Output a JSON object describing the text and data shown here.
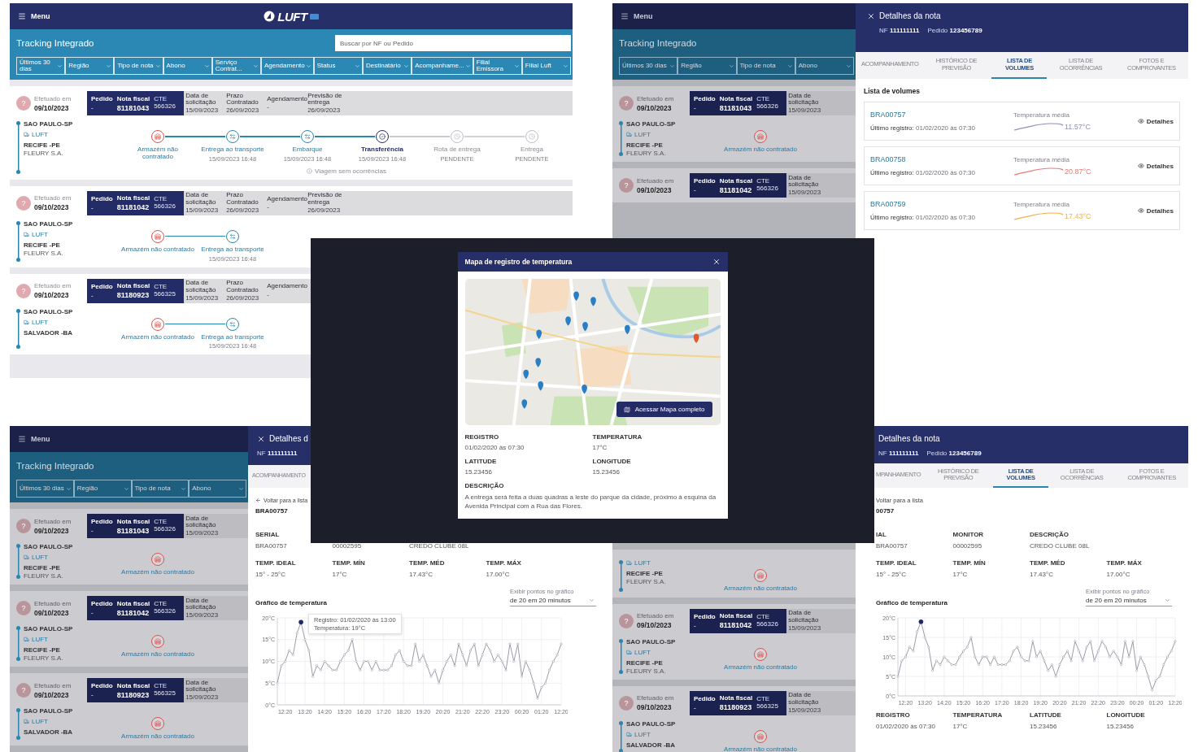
{
  "tracking_screen": {
    "dimmed": false,
    "menu": "Menu",
    "logo": "LUFT",
    "title": "Tracking Integrado",
    "search": {
      "placeholder": "Buscar por NF ou Pedido"
    },
    "filters": [
      "Últimos 30 dias",
      "Região",
      "Tipo de nota",
      "Abono",
      "Serviço Contrat...",
      "Agendamento",
      "Status",
      "Destinatário",
      "Acompanhame...",
      "Filial Emissora",
      "Filial Luft"
    ],
    "cards": [
      {
        "avatar": "?",
        "date_label": "Efetuado em",
        "date": "09/10/2023",
        "order_label": "Pedido",
        "order": "-",
        "invoice_label": "Nota fiscal",
        "invoice": "81181043",
        "cte": "CTE 566326",
        "info": [
          {
            "label": "Data de solicitação",
            "value": "15/09/2023"
          },
          {
            "label": "Prazo Contratado",
            "value": "26/09/2023"
          },
          {
            "label": "Agendamento",
            "value": "-"
          },
          {
            "label": "Previsão de entrega",
            "value": "26/09/2023"
          }
        ],
        "origin": "SAO PAULO-SP",
        "carrier": "LUFT",
        "destination": "RECIFE -PE",
        "company": "FLEURY S.A.",
        "steps": [
          {
            "kind": "alert",
            "label": "Armazém não contratado"
          },
          {
            "kind": "done",
            "label": "Entrega ao transporte",
            "time": "15/09/2023 16:48"
          },
          {
            "kind": "done",
            "label": "Embarque",
            "time": "15/09/2023 16:48"
          },
          {
            "kind": "current",
            "label": "Transferência",
            "time": "15/09/2023 16:48"
          },
          {
            "kind": "pending",
            "label": "Rota de entrega",
            "time": "PENDENTE"
          },
          {
            "kind": "pending",
            "label": "Entrega",
            "time": "PENDENTE"
          }
        ],
        "footer": "Viagem sem ocorrências"
      },
      {
        "avatar": "?",
        "date_label": "Efetuado em",
        "date": "09/10/2023",
        "order_label": "Pedido",
        "order": "-",
        "invoice_label": "Nota fiscal",
        "invoice": "81181042",
        "cte": "CTE 566326",
        "info": [
          {
            "label": "Data de solicitação",
            "value": "15/09/2023"
          },
          {
            "label": "Prazo Contratado",
            "value": "26/09/2023"
          },
          {
            "label": "Agendamento",
            "value": "-"
          },
          {
            "label": "Previsão de entrega",
            "value": "26/09/2023"
          }
        ],
        "origin": "SAO PAULO-SP",
        "carrier": "LUFT",
        "destination": "RECIFE -PE",
        "company": "FLEURY S.A.",
        "steps": [
          {
            "kind": "alert",
            "label": "Armazém não contratado"
          },
          {
            "kind": "done",
            "label": "Entrega ao transporte",
            "time": "15/09/2023 16:48"
          }
        ]
      },
      {
        "avatar": "?",
        "date_label": "Efetuado em",
        "date": "09/10/2023",
        "order_label": "Pedido",
        "order": "-",
        "invoice_label": "Nota fiscal",
        "invoice": "81180923",
        "cte": "CTE 566325",
        "info": [
          {
            "label": "Data de solicitação",
            "value": "15/09/2023"
          },
          {
            "label": "Prazo Contratado",
            "value": "26/09/2023"
          },
          {
            "label": "Agendamento",
            "value": "-"
          }
        ],
        "origin": "SAO PAULO-SP",
        "carrier": "LUFT",
        "destination": "SALVADOR -BA",
        "steps": [
          {
            "kind": "alert",
            "label": "Armazém não contratado"
          },
          {
            "kind": "done",
            "label": "Entrega ao transporte",
            "time": "15/09/2023 16:48"
          }
        ]
      }
    ]
  },
  "volumes_view": {
    "background": {
      "dimmed": true,
      "menu": "Menu",
      "title": "Tracking Integrado",
      "filters": [
        "Últimos 30 dias",
        "Região",
        "Tipo de nota",
        "Abono"
      ],
      "cards": [
        {
          "avatar": "?",
          "date_label": "Efetuado em",
          "date": "09/10/2023",
          "order_label": "Pedido",
          "order": "-",
          "invoice_label": "Nota fiscal",
          "invoice": "81181043",
          "cte": "CTE 566326",
          "info": [
            {
              "label": "Data de solicitação",
              "value": "15/09/2023"
            }
          ],
          "origin": "SAO PAULO-SP",
          "carrier": "LUFT",
          "destination": "RECIFE -PE",
          "company": "FLEURY S.A.",
          "steps": [
            {
              "kind": "alert",
              "label": "Armazém não contratado"
            }
          ]
        },
        {
          "avatar": "?",
          "date_label": "Efetuado em",
          "date": "09/10/2023",
          "order_label": "Pedido",
          "order": "-",
          "invoice_label": "Nota fiscal",
          "invoice": "81181042",
          "cte": "CTE 566326",
          "info": [
            {
              "label": "Data de solicitação",
              "value": "15/09/2023"
            }
          ]
        }
      ]
    },
    "drawer": {
      "close": true,
      "title": "Detalhes da nota",
      "nf": "NF **111111111**",
      "order": "Pedido **123456789**",
      "tabs": [
        {
          "label": "ACOMPANHAMENTO",
          "selected": false
        },
        {
          "label": "HISTÓRICO DE PREVISÃO",
          "selected": false
        },
        {
          "label": "LISTA DE VOLUMES",
          "selected": true
        },
        {
          "label": "LISTA DE OCORRÊNCIAS",
          "selected": false
        },
        {
          "label": "FOTOS E COMPROVANTES",
          "selected": false
        }
      ],
      "section_title": "Lista de volumes",
      "volumes": [
        {
          "code": "BRA00757",
          "last": "**Último registro:** 01/02/2020 às 07:30",
          "temp_label": "Temperatura média",
          "temp": "11.57°C",
          "color": "#8d8fba",
          "action": "Detalhes"
        },
        {
          "code": "BRA00758",
          "last": "**Último registro:** 01/02/2020 às 07:30",
          "temp_label": "Temperatura média",
          "temp": "20.87°C",
          "color": "#e8797a",
          "action": "Detalhes"
        },
        {
          "code": "BRA00759",
          "last": "**Último registro:** 01/02/2020 às 07:30",
          "temp_label": "Temperatura média",
          "temp": "17.43°C",
          "color": "#f2b04a",
          "action": "Detalhes"
        }
      ]
    }
  },
  "map_view": {
    "modal": {
      "title": "Mapa de registro de temperatura",
      "map_button": "Acessar Mapa completo",
      "fields": [
        {
          "label": "REGISTRO",
          "value": "01/02/2020 às 07:30"
        },
        {
          "label": "TEMPERATURA",
          "value": "17°C"
        },
        {
          "label": "LATITUDE",
          "value": "15.23456"
        },
        {
          "label": "LONGITUDE",
          "value": "15.23456"
        }
      ],
      "description_label": "DESCRIÇÃO",
      "description": "A entrega será feita a duas quadras a leste do parque da cidade, próximo à esquina da Avenida Principal com a Rua das Flores."
    }
  },
  "chart_view_left": {
    "background": {
      "dimmed": true,
      "menu": "Menu",
      "title": "Tracking Integrado",
      "filters": [
        "Últimos 30 dias",
        "Região",
        "Tipo de nota",
        "Abono"
      ],
      "cards": [
        {
          "avatar": "?",
          "date_label": "Efetuado em",
          "date": "09/10/2023",
          "order_label": "Pedido",
          "order": "-",
          "invoice_label": "Nota fiscal",
          "invoice": "81181043",
          "cte": "CTE 566326",
          "info": [
            {
              "label": "Data de solicitação",
              "value": "15/09/2023"
            }
          ],
          "origin": "SAO PAULO-SP",
          "carrier": "LUFT",
          "destination": "RECIFE -PE",
          "company": "FLEURY S.A.",
          "steps": [
            {
              "kind": "alert",
              "label": "Armazém não contratado"
            }
          ]
        },
        {
          "avatar": "?",
          "date_label": "Efetuado em",
          "date": "09/10/2023",
          "order_label": "Pedido",
          "order": "-",
          "invoice_label": "Nota fiscal",
          "invoice": "81181042",
          "cte": "CTE 566326",
          "info": [
            {
              "label": "Data de solicitação",
              "value": "15/09/2023"
            }
          ],
          "origin": "SAO PAULO-SP",
          "carrier": "LUFT",
          "destination": "RECIFE -PE",
          "company": "FLEURY S.A.",
          "steps": [
            {
              "kind": "alert",
              "label": "Armazém não contratado"
            }
          ]
        },
        {
          "avatar": "?",
          "date_label": "Efetuado em",
          "date": "09/10/2023",
          "order_label": "Pedido",
          "order": "-",
          "invoice_label": "Nota fiscal",
          "invoice": "81180923",
          "cte": "CTE 566325",
          "info": [
            {
              "label": "Data de solicitação",
              "value": "15/09/2023"
            }
          ],
          "origin": "SAO PAULO-SP",
          "carrier": "LUFT",
          "destination": "SALVADOR -BA",
          "steps": [
            {
              "kind": "alert",
              "label": "Armazém não contratado"
            }
          ]
        }
      ]
    },
    "drawer": {
      "close": true,
      "title": "Detalhes d",
      "nf": "NF **111111111**",
      "tabs": [
        {
          "label": "ACOMPANHAMENTO",
          "selected": false
        }
      ],
      "back": "Voltar para a lista",
      "volume": "BRA00757",
      "fields": [
        {
          "label": "SERIAL",
          "value": "BRA00757"
        },
        {
          "value": "00002595"
        },
        {
          "value": "CREDO CLUBE 08L"
        }
      ],
      "temps": [
        {
          "label": "TEMP. IDEAL",
          "value": "15° - 25°C"
        },
        {
          "label": "TEMP. MÍN",
          "value": "17°C"
        },
        {
          "label": "TEMP. MÉD",
          "value": "17.43°C"
        },
        {
          "label": "TEMP. MÁX",
          "value": "17.00°C"
        }
      ],
      "chart_title": "Gráfico de temperatura",
      "select": {
        "label": "Exibir pontos no gráfico",
        "value": "de 20 em 20 minutos"
      },
      "chart_data": {
        "type": "line",
        "grid": true,
        "marker": true,
        "ylim": [
          0,
          20
        ],
        "yticks": [
          {
            "value": 0,
            "label": "0°C"
          },
          {
            "value": 5,
            "label": "5°C"
          },
          {
            "value": 10,
            "label": "10°C"
          },
          {
            "value": 15,
            "label": "15°C"
          },
          {
            "value": 20,
            "label": "20°C"
          }
        ],
        "categories": [
          null,
          null,
          "12:20",
          null,
          null,
          null,
          null,
          "13:20",
          null,
          null,
          null,
          null,
          "14:20",
          null,
          null,
          null,
          null,
          "15:20",
          null,
          null,
          null,
          null,
          "16:20",
          null,
          null,
          null,
          null,
          "17:20",
          null,
          null,
          null,
          null,
          "18:20",
          null,
          null,
          null,
          null,
          "19:20",
          null,
          null,
          null,
          null,
          "20:20",
          null,
          null,
          null,
          null,
          "21:20",
          null,
          null,
          null,
          null,
          "22:20",
          null,
          null,
          null,
          null,
          "23:20",
          null,
          null,
          null,
          null,
          "00:20",
          null,
          null,
          null,
          null,
          "01:20",
          null,
          null,
          null,
          null,
          "12:20"
        ],
        "values": [
          5,
          9,
          10,
          12.5,
          11.5,
          16.5,
          19,
          15,
          12.5,
          6.5,
          9,
          8,
          10,
          9,
          8,
          8,
          10,
          11.5,
          12.5,
          15,
          10,
          8,
          10,
          10,
          8,
          10,
          8,
          8,
          8,
          9,
          11.5,
          12.5,
          10,
          9,
          9,
          14,
          10,
          11.5,
          9,
          6.5,
          8,
          5,
          8,
          10,
          11.5,
          9,
          14,
          11.5,
          9,
          12.5,
          14,
          9,
          11.5,
          14,
          12.5,
          10,
          11.5,
          10,
          8,
          14,
          10,
          14,
          6.5,
          10,
          8,
          5,
          1.5,
          4,
          5,
          8,
          10,
          11.5,
          14
        ]
      },
      "tooltip": [
        "Registro: 01/02/2020 às 13:00",
        "Temperatura: 19°C"
      ]
    }
  },
  "chart_view_right": {
    "background": {
      "dimmed": true,
      "cards": [
        {
          "carrier": "LUFT",
          "destination": "RECIFE -PE",
          "company": "FLEURY S.A.",
          "steps": [
            {
              "kind": "alert",
              "label": "Armazém não contratado"
            }
          ]
        },
        {
          "avatar": "?",
          "date_label": "Efetuado em",
          "date": "09/10/2023",
          "order_label": "Pedido",
          "order": "-",
          "invoice_label": "Nota fiscal",
          "invoice": "81181042",
          "cte": "CTE 566326",
          "info": [
            {
              "label": "Data de solicitação",
              "value": "15/09/2023"
            }
          ],
          "origin": "SAO PAULO-SP",
          "carrier": "LUFT",
          "destination": "RECIFE -PE",
          "company": "FLEURY S.A.",
          "steps": [
            {
              "kind": "alert",
              "label": "Armazém não contratado"
            }
          ]
        },
        {
          "avatar": "?",
          "date_label": "Efetuado em",
          "date": "09/10/2023",
          "order_label": "Pedido",
          "order": "-",
          "invoice_label": "Nota fiscal",
          "invoice": "81180923",
          "cte": "CTE 566325",
          "info": [
            {
              "label": "Data de solicitação",
              "value": "15/09/2023"
            }
          ],
          "origin": "SAO PAULO-SP",
          "carrier": "LUFT",
          "destination": "SALVADOR -BA",
          "steps": [
            {
              "kind": "alert",
              "label": "Armazém não contratado"
            }
          ]
        }
      ]
    },
    "drawer": {
      "title": "Detalhes da nota",
      "nf": "NF **111111111**",
      "order": "Pedido **123456789**",
      "tabs": [
        {
          "label": "MPANHAMENTO",
          "selected": false
        },
        {
          "label": "HISTÓRICO DE PREVISÃO",
          "selected": false
        },
        {
          "label": "LISTA DE VOLUMES",
          "selected": true
        },
        {
          "label": "LISTA DE OCORRÊNCIAS",
          "selected": false
        },
        {
          "label": "FOTOS E COMPROVANTES",
          "selected": false
        }
      ],
      "back": "Voltar para a lista",
      "volume": "00757",
      "fields": [
        {
          "label": "IAL",
          "value": "BRA00757"
        },
        {
          "label": "MONITOR",
          "value": "00002595"
        },
        {
          "label": "DESCRIÇÃO",
          "value": "CREDO CLUBE 08L"
        }
      ],
      "temps": [
        {
          "label": "TEMP. IDEAL",
          "value": "15° - 25°C"
        },
        {
          "label": "TEMP. MÍN",
          "value": "17°C"
        },
        {
          "label": "TEMP. MÉD",
          "value": "17.43°C"
        },
        {
          "label": "TEMP. MÁX",
          "value": "17.00°C"
        }
      ],
      "chart_title": "Gráfico de temperatura",
      "select": {
        "label": "Exibir pontos no gráfico",
        "value": "de 20 em 20 minutos"
      },
      "chart_data": {
        "type": "line",
        "grid": true,
        "marker": true,
        "ylim": [
          0,
          20
        ],
        "yticks": [
          {
            "value": 0,
            "label": "0°C"
          },
          {
            "value": 5,
            "label": "5°C"
          },
          {
            "value": 10,
            "label": "10°C"
          },
          {
            "value": 15,
            "label": "15°C"
          },
          {
            "value": 20,
            "label": "20°C"
          }
        ],
        "categories": [
          null,
          null,
          "12:20",
          null,
          null,
          null,
          null,
          "13:20",
          null,
          null,
          null,
          null,
          "14:20",
          null,
          null,
          null,
          null,
          "15:20",
          null,
          null,
          null,
          null,
          "16:20",
          null,
          null,
          null,
          null,
          "17:20",
          null,
          null,
          null,
          null,
          "18:20",
          null,
          null,
          null,
          null,
          "19:20",
          null,
          null,
          null,
          null,
          "20:20",
          null,
          null,
          null,
          null,
          "21:20",
          null,
          null,
          null,
          null,
          "22:20",
          null,
          null,
          null,
          null,
          "23:20",
          null,
          null,
          null,
          null,
          "00:20",
          null,
          null,
          null,
          null,
          "01:20",
          null,
          null,
          null,
          null,
          "12:20"
        ],
        "values": [
          5,
          9,
          10,
          12.5,
          11.5,
          16.5,
          19,
          15,
          12.5,
          6.5,
          9,
          8,
          10,
          9,
          8,
          8,
          10,
          11.5,
          12.5,
          15,
          10,
          8,
          10,
          10,
          8,
          10,
          8,
          8,
          8,
          9,
          11.5,
          12.5,
          10,
          9,
          9,
          14,
          10,
          11.5,
          9,
          6.5,
          8,
          5,
          8,
          10,
          11.5,
          9,
          14,
          11.5,
          9,
          12.5,
          14,
          9,
          11.5,
          14,
          12.5,
          10,
          11.5,
          10,
          8,
          14,
          10,
          14,
          6.5,
          10,
          8,
          5,
          1.5,
          4,
          5,
          8,
          10,
          11.5,
          14
        ]
      },
      "bottom_fields": [
        {
          "label": "REGISTRO",
          "value": "01/02/2020 às 07:30"
        },
        {
          "label": "TEMPERATURA",
          "value": "17°C"
        },
        {
          "label": "LATITUDE",
          "value": "15.23456"
        },
        {
          "label": "LONGITUDE",
          "value": "15.23456"
        }
      ]
    }
  }
}
